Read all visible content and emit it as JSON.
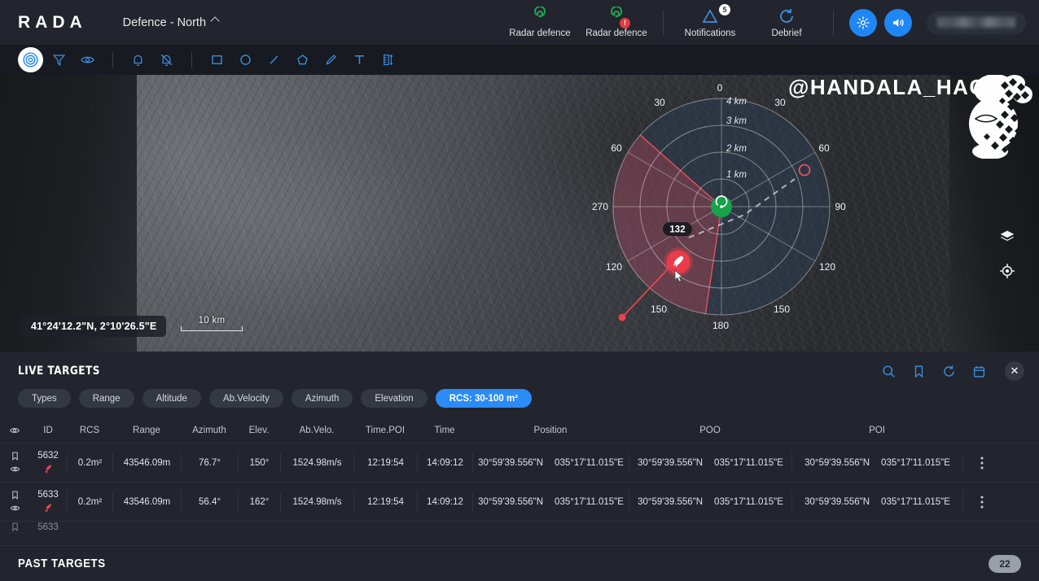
{
  "header": {
    "logo": "RADA",
    "workspace": "Defence - North",
    "items": [
      {
        "icon": "radar-icon",
        "label": "Radar defence",
        "badge": ""
      },
      {
        "icon": "radar-alert-icon",
        "label": "Radar defence",
        "badge": "!"
      },
      {
        "icon": "notifications-icon",
        "label": "Notifications",
        "badge": "5"
      },
      {
        "icon": "debrief-refresh-icon",
        "label": "Debrief",
        "badge": ""
      }
    ],
    "settings_icon": "gear-icon",
    "sound_icon": "speaker-icon"
  },
  "toolbar": {
    "tools": [
      {
        "name": "target-radar-icon",
        "active": true
      },
      {
        "name": "filter-icon",
        "active": false
      },
      {
        "name": "eye-icon",
        "active": false
      },
      {
        "name": "bell-icon",
        "active": false
      },
      {
        "name": "bell-off-icon",
        "active": false
      },
      {
        "name": "rectangle-icon",
        "active": false
      },
      {
        "name": "circle-icon",
        "active": false
      },
      {
        "name": "line-icon",
        "active": false
      },
      {
        "name": "polygon-icon",
        "active": false
      },
      {
        "name": "pencil-icon",
        "active": false
      },
      {
        "name": "text-icon",
        "active": false
      },
      {
        "name": "measure-icon",
        "active": false
      }
    ]
  },
  "map": {
    "coordinates": "41°24'12.2\"N, 2°10'26.5\"E",
    "scale_label": "10 km",
    "watermark": "@HANDALA_HACK",
    "controls": {
      "layers": "layers-icon",
      "locate": "locate-crosshair-icon",
      "zoom_out": "−",
      "zoom_in": "+"
    }
  },
  "radar": {
    "range_rings": [
      "1 km",
      "2 km",
      "3 km",
      "4 km"
    ],
    "azimuth_labels_top": [
      "0"
    ],
    "azimuth_labels": [
      "30",
      "30",
      "60",
      "60",
      "270",
      "90",
      "120",
      "120",
      "150",
      "150",
      "180"
    ],
    "target_label": "132",
    "target_icon": "rocket-icon",
    "center_icon": "radar-station-icon",
    "sector_color": "#e04a5a",
    "track_color": "#e8434f"
  },
  "panel": {
    "title": "LIVE TARGETS",
    "actions": [
      {
        "name": "search-icon"
      },
      {
        "name": "bookmark-icon"
      },
      {
        "name": "refresh-icon"
      },
      {
        "name": "calendar-icon"
      }
    ],
    "close_label": "✕",
    "chips": [
      {
        "label": "Types",
        "active": false
      },
      {
        "label": "Range",
        "active": false
      },
      {
        "label": "Altitude",
        "active": false
      },
      {
        "label": "Ab.Velocity",
        "active": false
      },
      {
        "label": "Azimuth",
        "active": false
      },
      {
        "label": "Elevation",
        "active": false
      },
      {
        "label": "RCS: 30-100 m²",
        "active": true
      }
    ],
    "columns": [
      "",
      "ID",
      "RCS",
      "Range",
      "Azimuth",
      "Elev.",
      "Ab.Velo.",
      "Time.POI",
      "Time",
      "Position",
      "POO",
      "POI",
      ""
    ],
    "rows": [
      {
        "id": "5632",
        "rcs": "0.2m²",
        "range": "43546.09m",
        "azimuth": "76.7°",
        "elev": "150°",
        "velocity": "1524.98m/s",
        "time_poi": "12:19:54",
        "time": "14:09:12",
        "position_lat": "30°59'39.556\"N",
        "position_lon": "035°17'11.015\"E",
        "poo_lat": "30°59'39.556\"N",
        "poo_lon": "035°17'11.015\"E",
        "poi_lat": "30°59'39.556\"N",
        "poi_lon": "035°17'11.015\"E"
      },
      {
        "id": "5633",
        "rcs": "0.2m²",
        "range": "43546.09m",
        "azimuth": "56.4°",
        "elev": "162°",
        "velocity": "1524.98m/s",
        "time_poi": "12:19:54",
        "time": "14:09:12",
        "position_lat": "30°59'39.556\"N",
        "position_lon": "035°17'11.015\"E",
        "poo_lat": "30°59'39.556\"N",
        "poo_lon": "035°17'11.015\"E",
        "poi_lat": "30°59'39.556\"N",
        "poi_lon": "035°17'11.015\"E"
      }
    ],
    "partial_row_id": "5633"
  },
  "footer": {
    "title": "PAST TARGETS",
    "count": "22"
  },
  "colors": {
    "accent": "#2b8cf5",
    "radar_green": "#16a34a",
    "alert_red": "#e03c3c",
    "panel_bg": "#22252d",
    "toolbar_bg": "#171a21"
  }
}
